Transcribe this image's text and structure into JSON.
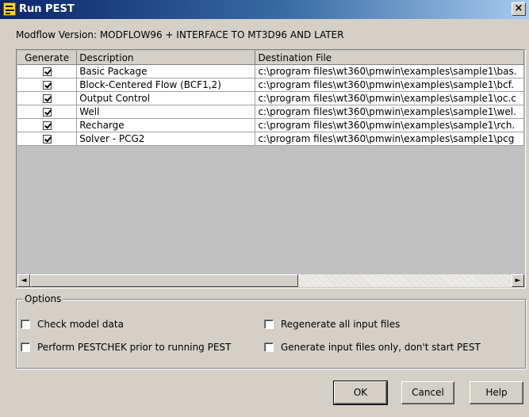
{
  "window": {
    "title": "Run PEST",
    "close_glyph": "×"
  },
  "version_text": "Modflow Version: MODFLOW96 + INTERFACE TO MT3D96 AND LATER",
  "table": {
    "headers": [
      "Generate",
      "Description",
      "Destination File"
    ],
    "rows": [
      {
        "checked": true,
        "description": "Basic Package",
        "destination": "c:\\program files\\wt360\\pmwin\\examples\\sample1\\bas."
      },
      {
        "checked": true,
        "description": "Block-Centered Flow (BCF1,2)",
        "destination": "c:\\program files\\wt360\\pmwin\\examples\\sample1\\bcf."
      },
      {
        "checked": true,
        "description": "Output Control",
        "destination": "c:\\program files\\wt360\\pmwin\\examples\\sample1\\oc.c"
      },
      {
        "checked": true,
        "description": "Well",
        "destination": "c:\\program files\\wt360\\pmwin\\examples\\sample1\\wel."
      },
      {
        "checked": true,
        "description": "Recharge",
        "destination": "c:\\program files\\wt360\\pmwin\\examples\\sample1\\rch."
      },
      {
        "checked": true,
        "description": "Solver - PCG2",
        "destination": "c:\\program files\\wt360\\pmwin\\examples\\sample1\\pcg"
      }
    ]
  },
  "scrollbar": {
    "left_arrow": "◄",
    "right_arrow": "►"
  },
  "options": {
    "legend": "Options",
    "check_model_data": {
      "label": "Check model data",
      "checked": false
    },
    "perform_pestchek": {
      "label": "Perform PESTCHEK prior to running PEST",
      "checked": false
    },
    "regenerate_all": {
      "label": "Regenerate all input files",
      "checked": false
    },
    "generate_only": {
      "label": "Generate input files only, don't start PEST",
      "checked": false
    }
  },
  "buttons": {
    "ok": "OK",
    "cancel": "Cancel",
    "help": "Help"
  },
  "colors": {
    "title_start": "#0a246a",
    "title_end": "#a6caf0",
    "face": "#d4d0c8"
  }
}
